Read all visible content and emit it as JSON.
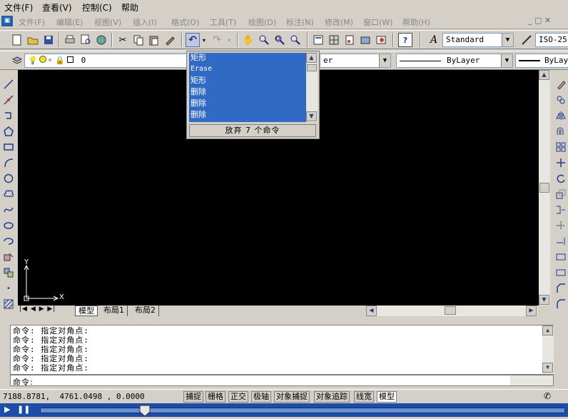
{
  "menubar": {
    "items": [
      "文件(F)",
      "查看(V)",
      "控制(C)",
      "帮助"
    ]
  },
  "app_menu": {
    "items": [
      "文件(F)",
      "编辑(E)",
      "视图(V)",
      "插入(I)",
      "格式(O)",
      "工具(T)",
      "绘图(D)",
      "标注(N)",
      "修改(M)",
      "窗口(W)",
      "帮助(H)"
    ]
  },
  "toolbar": {
    "text_style": "Standard",
    "dim_style": "ISO-25"
  },
  "layers": {
    "current_layer": "0",
    "color_partial": "er",
    "linetype": "ByLayer",
    "lineweight": "ByLayer"
  },
  "undo_popup": {
    "items": [
      "矩形",
      "Erase",
      "矩形",
      "删除",
      "删除",
      "删除"
    ],
    "footer": "放弃 7 个命令"
  },
  "ucs": {
    "y_label": "Y",
    "x_label": "X"
  },
  "tabs": [
    "模型",
    "布局1",
    "布局2"
  ],
  "command_history": [
    "命令: 指定对角点:",
    "命令: 指定对角点:",
    "命令: 指定对角点:",
    "命令: 指定对角点:",
    "命令: 指定对角点:"
  ],
  "command_prompt": "命令:",
  "status": {
    "coords": "7188.8781,  4761.0498 , 0.0000",
    "toggles": [
      "捕捉",
      "栅格",
      "正交",
      "极轴",
      "对象捕捉",
      "对象追踪",
      "线宽",
      "模型"
    ]
  },
  "player": {
    "progress": 0.2
  }
}
